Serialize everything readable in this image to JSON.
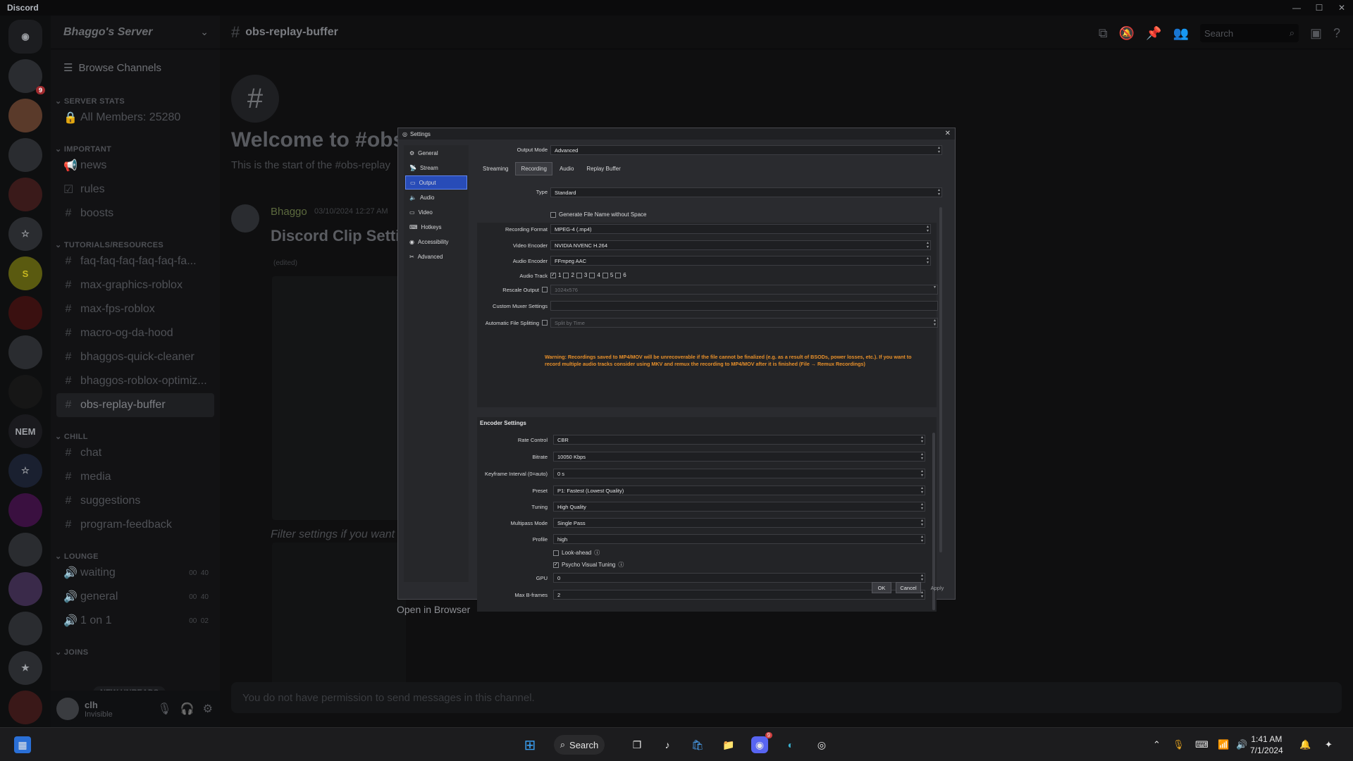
{
  "app": {
    "title": "Discord"
  },
  "server": {
    "name": "Bhaggo's Server",
    "browse": "Browse Channels",
    "categories": [
      {
        "name": "SERVER STATS",
        "channels": [
          {
            "label": "All Members: 25280",
            "icon": "lock-icon"
          }
        ]
      },
      {
        "name": "IMPORTANT",
        "channels": [
          {
            "label": "news",
            "icon": "megaphone-icon"
          },
          {
            "label": "rules",
            "icon": "rules-icon"
          },
          {
            "label": "boosts",
            "icon": "hash-icon"
          }
        ]
      },
      {
        "name": "TUTORIALS/RESOURCES",
        "channels": [
          {
            "label": "faq-faq-faq-faq-faq-fa..."
          },
          {
            "label": "max-graphics-roblox"
          },
          {
            "label": "max-fps-roblox"
          },
          {
            "label": "macro-og-da-hood"
          },
          {
            "label": "bhaggos-quick-cleaner"
          },
          {
            "label": "bhaggos-roblox-optimiz..."
          },
          {
            "label": "obs-replay-buffer"
          }
        ]
      },
      {
        "name": "CHILL",
        "channels": [
          {
            "label": "chat"
          },
          {
            "label": "media"
          },
          {
            "label": "suggestions"
          },
          {
            "label": "program-feedback"
          }
        ]
      },
      {
        "name": "LOUNGE",
        "channels": [
          {
            "label": "waiting",
            "c1": "00",
            "c2": "40"
          },
          {
            "label": "general",
            "c1": "00",
            "c2": "40"
          },
          {
            "label": "1 on 1",
            "c1": "00",
            "c2": "02"
          }
        ]
      },
      {
        "name": "JOINS"
      }
    ],
    "new_unreads": "NEW UNREADS"
  },
  "user": {
    "name": "clh",
    "status": "Invisible"
  },
  "channel": {
    "name": "obs-replay-buffer",
    "search_placeholder": "Search",
    "welcome_title": "Welcome to #obs",
    "welcome_sub": "This is the start of the #obs-replay",
    "message": {
      "author": "Bhaggo",
      "time": "03/10/2024 12:27 AM",
      "heading": "Discord Clip Setti",
      "edited": "(edited)",
      "italic": "Filter settings if you want"
    },
    "open_in_browser": "Open in Browser",
    "input_placeholder": "You do not have permission to send messages in this channel."
  },
  "settings": {
    "title": "Settings",
    "nav": [
      "General",
      "Stream",
      "Output",
      "Audio",
      "Video",
      "Hotkeys",
      "Accessibility",
      "Advanced"
    ],
    "nav_selected": 2,
    "output_mode_label": "Output Mode",
    "output_mode": "Advanced",
    "tabs": [
      "Streaming",
      "Recording",
      "Audio",
      "Replay Buffer"
    ],
    "tab_selected": 1,
    "type_label": "Type",
    "type": "Standard",
    "gen_filename": "Generate File Name without Space",
    "rec_format_label": "Recording Format",
    "rec_format": "MPEG-4 (.mp4)",
    "video_encoder_label": "Video Encoder",
    "video_encoder": "NVIDIA NVENC H.264",
    "audio_encoder_label": "Audio Encoder",
    "audio_encoder": "FFmpeg AAC",
    "audio_track_label": "Audio Track",
    "audio_tracks": [
      "1",
      "2",
      "3",
      "4",
      "5",
      "6"
    ],
    "rescale_label": "Rescale Output",
    "rescale_value": "1024x576",
    "muxer_label": "Custom Muxer Settings",
    "auto_split_label": "Automatic File Splitting",
    "auto_split_value": "Split by Time",
    "warning": "Warning: Recordings saved to MP4/MOV will be unrecoverable if the file cannot be finalized (e.g. as a result of BSODs, power losses, etc.). If you want to record multiple audio tracks consider using MKV and remux the recording to MP4/MOV after it is finished (File → Remux Recordings)",
    "encoder_title": "Encoder Settings",
    "encoder": [
      {
        "label": "Rate Control",
        "value": "CBR"
      },
      {
        "label": "Bitrate",
        "value": "10050 Kbps"
      },
      {
        "label": "Keyframe Interval (0=auto)",
        "value": "0 s"
      },
      {
        "label": "Preset",
        "value": "P1: Fastest (Lowest Quality)"
      },
      {
        "label": "Tuning",
        "value": "High Quality"
      },
      {
        "label": "Multipass Mode",
        "value": "Single Pass"
      },
      {
        "label": "Profile",
        "value": "high"
      }
    ],
    "lookahead": "Look-ahead",
    "psycho": "Psycho Visual Tuning",
    "gpu_label": "GPU",
    "gpu": "0",
    "bframes_label": "Max B-frames",
    "bframes": "2",
    "ok": "OK",
    "cancel": "Cancel",
    "apply": "Apply"
  },
  "taskbar": {
    "search": "Search",
    "time": "1:41 AM",
    "date": "7/1/2024",
    "discord_badge": "9"
  }
}
